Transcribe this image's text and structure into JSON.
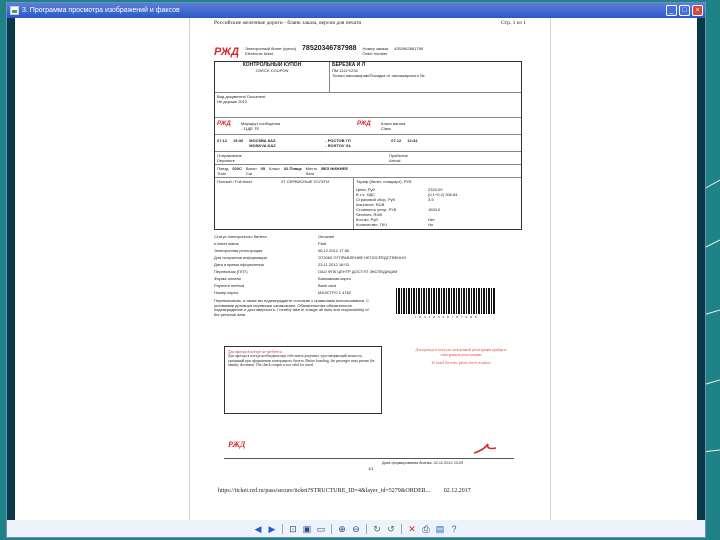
{
  "window": {
    "title": "3. Программа просмотра изображений и факсов"
  },
  "page": {
    "header_left": "Российские железные дороги - бланк заказа, версия для печати",
    "header_right": "Стр. 1 из 1",
    "ticket": {
      "ticket_type": "Электронный билет (купон)",
      "ticket_type_en": "Electronic ticket",
      "ticket_number": "78520346787988",
      "order_label": "Номер заказа",
      "order_label_en": "Order number",
      "order_number": "4252962891789",
      "coupon_title": "КОНТРОЛЬНЫЙ КУПОН",
      "coupon_subtitle": "CHECK COUPON",
      "passenger": "БЕРЕЗКА И Л",
      "passenger_note": "Только пассажирам/Посадка от пассажирского №",
      "pass_code": "ПМ 1111*1234",
      "issued_label": "Вид документа/ Document",
      "issued_date": "Не дороже 2012",
      "segment_route_label": "Маршрут сообщения",
      "segment_route": "- 11ДЕ ТЕ",
      "segment_right_label": "Класс вагона",
      "segment_right": "Class",
      "dep_date": "07.12",
      "dep_time": "15:30",
      "from_station": "МОСКВА КАЗ",
      "from_station_en": "MOSKVA KAZ",
      "to_station": "- РОСТОВ ГЛ",
      "to_station_en": "- ROSTOV GL",
      "arr_date": "07.12",
      "arr_time": "12:34",
      "dep_label": "Отправление",
      "dep_label_en": "Departure",
      "arr_label": "Прибытие",
      "arr_label_en": "Arrival",
      "train_label": "Поезд",
      "train_label_en": "Train",
      "train": "020С",
      "car_label": "Вагон",
      "car_label_en": "Car",
      "car": "05",
      "service_label": "Класс",
      "service": "02 Плацк",
      "seat_label": "Место",
      "seat_label_en": "Seat",
      "seat": "ВЕЗ НИЖНЕЕ",
      "full_label": "Полный / Full ticket",
      "service_info": "2Т СЕРВИСНЫЕ УСЛУГИ",
      "tarif_label": "Тариф (билет, плацкарт), РУБ",
      "tarif_items": [
        {
          "label": "Цена, Руб",
          "value": "2323.00"
        },
        {
          "label": "В т.ч. НДС",
          "value": "(0.1+0.2) 306.84"
        },
        {
          "label": "Страховой сбор, Руб",
          "value": "3.5"
        },
        {
          "label": "Insurance, RUB",
          "value": ""
        },
        {
          "label": "Стоимость услуг, РУБ",
          "value": "1603.0"
        },
        {
          "label": "Services, RUB",
          "value": ""
        },
        {
          "label": "Кол-во, Руб",
          "value": "Нет"
        },
        {
          "label": "Количество, ГКЧ",
          "value": "Но"
        }
      ],
      "info": [
        {
          "label": "Статус электронного билета",
          "value": "Оплачен"
        },
        {
          "label": "e-ticket status",
          "value": "Paid"
        },
        {
          "label": "Электронная регистрация",
          "value": "06.12.2012 17:55"
        },
        {
          "label": "Для получения информации",
          "value": "ЭТ2060 ОТПРАВЛЕНИЕ НЕПОСРЕДСТВЕННО"
        },
        {
          "label": "Дата и время оформления",
          "value": "23.11.2012 16:03"
        },
        {
          "label": "Перевозчик (ППТ)",
          "value": "ОАО ФПК ЦЕНТР ДОСТУП ЭКСПЕДИЦИИ"
        },
        {
          "label": "Форма оплаты",
          "value": "Банковская карта"
        },
        {
          "label": "Payment method",
          "value": "Bank card"
        },
        {
          "label": "Номер карты",
          "value": "МАЭСТРО 1 4762"
        }
      ],
      "disclaimer": "Перевозчиком, а также вы подтверждаете согласие с правилами использования. С условиями договора перевозки ознакомлен. Обязательства обязательное подтверждение и достоверность. I hereby take in charge all risks and responsibility of the personal data.",
      "barcode_digits": "7 6 5 2 0 3 4 6 7 8 7 9 8 8",
      "note_box_red": "Для проезда в поезде: не требуется",
      "note_box_text": "Для проезда в поезде необходимо при себе иметь документ, удостоверяющий личность, указанный при оформлении электронного билета. Before boarding, the passenger must present the identity document. The check coupon is not valid for travel.",
      "red_right_1": "Для прохода в поезд на электронной регистрации пройдите электронную регистрацию",
      "red_right_2": "To board the train, please check in online",
      "footer_date": "Дата формирования бланка: 02.12.2012 23:29",
      "footer_page": "1/1"
    },
    "url": "https://ticket.rzd.ru/pass/secure/ticket?STRUCTURE_ID=4&layer_id=5279&ORDER...",
    "url_date": "02.12.2017"
  },
  "colors": {
    "frame": "#1e8287",
    "brand_red": "#d8282c"
  },
  "toolbar": {
    "icons": [
      "prev-image-icon",
      "next-image-icon",
      "best-fit-icon",
      "actual-size-icon",
      "slideshow-icon",
      "zoom-in-icon",
      "zoom-out-icon",
      "rotate-cw-icon",
      "rotate-ccw-icon",
      "delete-icon",
      "print-icon",
      "save-icon",
      "help-icon"
    ]
  }
}
